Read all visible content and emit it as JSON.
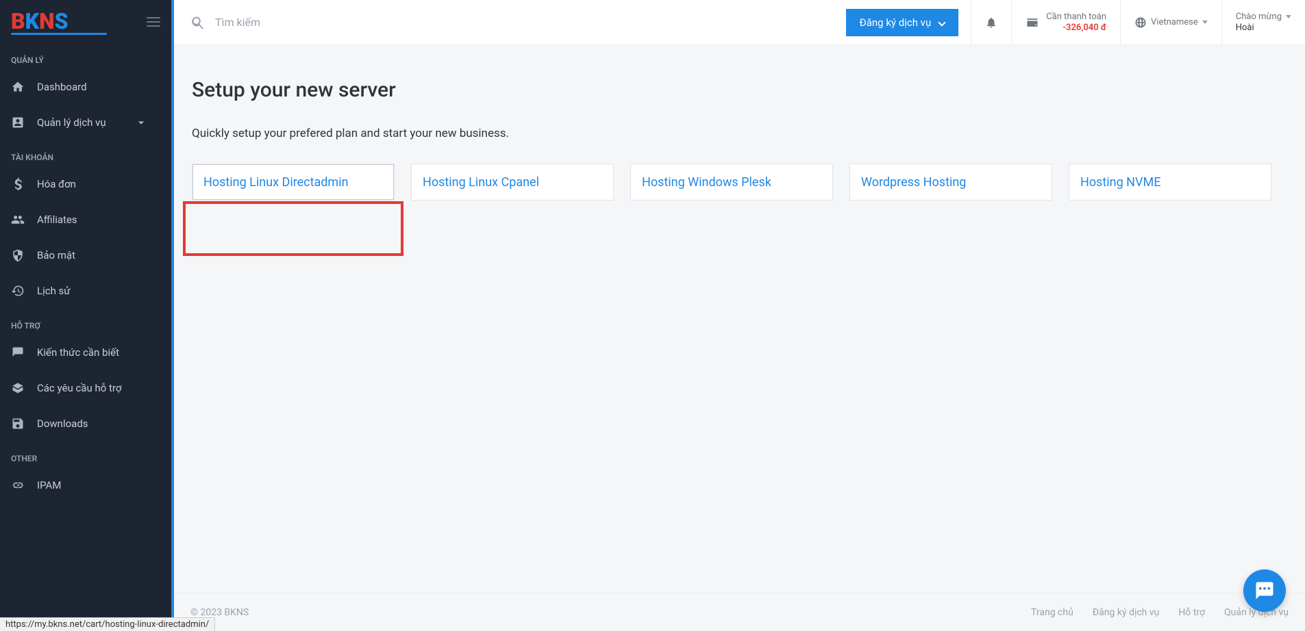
{
  "sidebar": {
    "sections": {
      "manage_label": "QUẢN LÝ",
      "account_label": "TÀI KHOẢN",
      "support_label": "HỖ TRỢ",
      "other_label": "OTHER"
    },
    "items": {
      "dashboard": "Dashboard",
      "services": "Quản lý dịch vụ",
      "invoice": "Hóa đơn",
      "affiliates": "Affiliates",
      "security": "Bảo mật",
      "history": "Lịch sử",
      "knowledge": "Kiến thức cần biết",
      "requests": "Các yêu cầu hỗ trợ",
      "downloads": "Downloads",
      "ipam": "IPAM"
    }
  },
  "topbar": {
    "search_placeholder": "Tìm kiếm",
    "register_label": "Đăng ký dịch vụ",
    "balance_label": "Cần thanh toán",
    "balance_value": "-326,040 đ",
    "language": "Vietnamese",
    "greeting": "Chào mừng",
    "username": "Hoài"
  },
  "page": {
    "title": "Setup your new server",
    "subtitle": "Quickly setup your prefered plan and start your new business.",
    "tiles": {
      "t1": "Hosting Linux Directadmin",
      "t2": "Hosting Linux Cpanel",
      "t3": "Hosting Windows Plesk",
      "t4": "Wordpress Hosting",
      "t5": "Hosting NVME"
    }
  },
  "footer": {
    "copyright": "© 2023 BKNS",
    "links": {
      "home": "Trang chủ",
      "register": "Đăng ký dịch vụ",
      "support": "Hỗ trợ",
      "services": "Quản lý dịch vụ"
    }
  },
  "status_url": "https://my.bkns.net/cart/hosting-linux-directadmin/"
}
